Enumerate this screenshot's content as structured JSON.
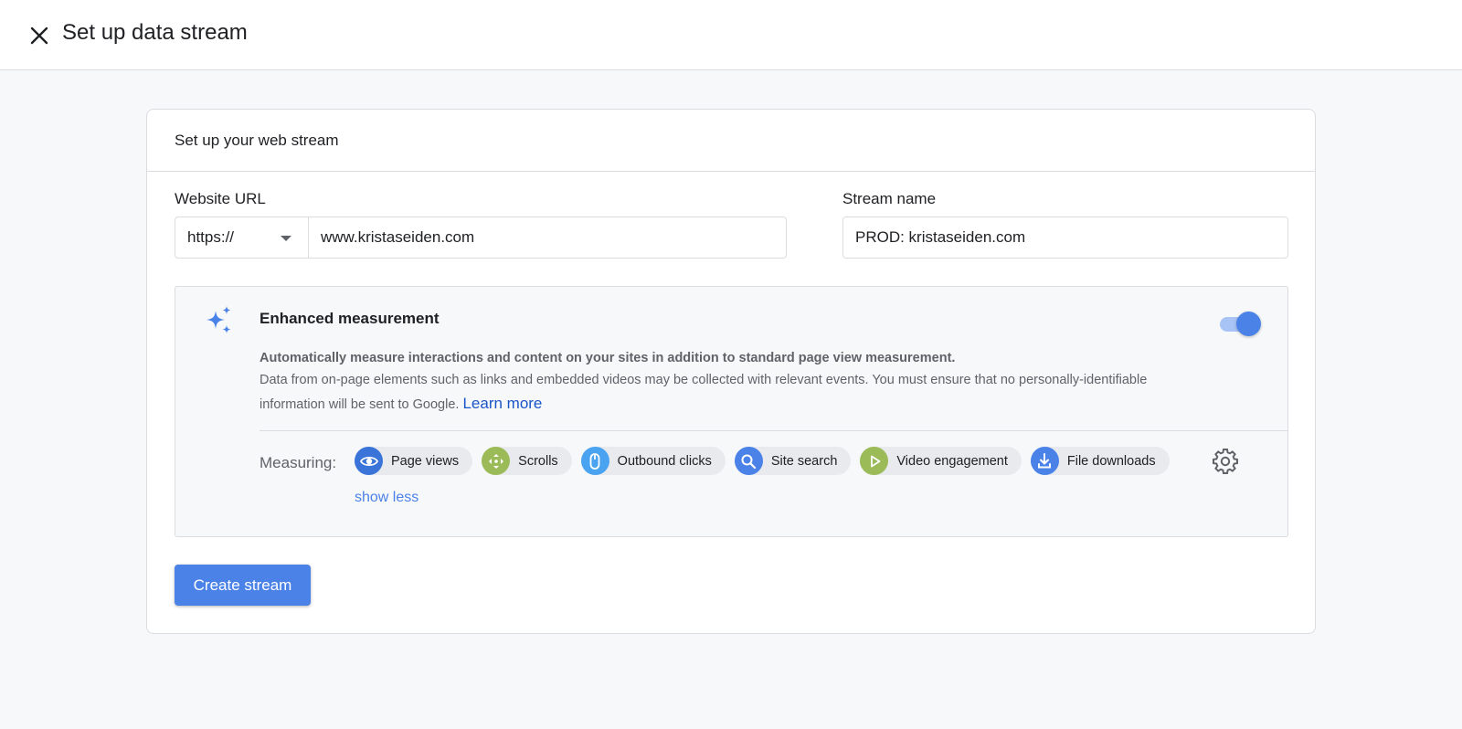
{
  "header": {
    "title": "Set up data stream",
    "close_icon": "close-icon"
  },
  "card": {
    "title": "Set up your web stream",
    "website_url": {
      "label": "Website URL",
      "protocol": "https://",
      "value": "www.kristaseiden.com"
    },
    "stream_name": {
      "label": "Stream name",
      "value": "PROD: kristaseiden.com"
    },
    "enhanced_measurement": {
      "title": "Enhanced measurement",
      "enabled": true,
      "description_bold": "Automatically measure interactions and content on your sites in addition to standard page view measurement.",
      "description": "Data from on-page elements such as links and embedded videos may be collected with relevant events. You must ensure that no personally-identifiable information will be sent to Google.",
      "learn_more": "Learn more",
      "measuring_label": "Measuring:",
      "chips": [
        {
          "label": "Page views",
          "icon": "eye-icon",
          "color": "#3b74d9"
        },
        {
          "label": "Scrolls",
          "icon": "scroll-arrows-icon",
          "color": "#9bbb59"
        },
        {
          "label": "Outbound clicks",
          "icon": "mouse-icon",
          "color": "#4aa3f0"
        },
        {
          "label": "Site search",
          "icon": "search-icon",
          "color": "#4b82e8"
        },
        {
          "label": "Video engagement",
          "icon": "play-icon",
          "color": "#9bbb59"
        },
        {
          "label": "File downloads",
          "icon": "download-icon",
          "color": "#4b82e8"
        }
      ],
      "show_less": "show less"
    },
    "create_button": "Create stream"
  },
  "colors": {
    "accent": "#4b82e8",
    "link": "#1a55c8",
    "background": "#f7f8fa"
  }
}
